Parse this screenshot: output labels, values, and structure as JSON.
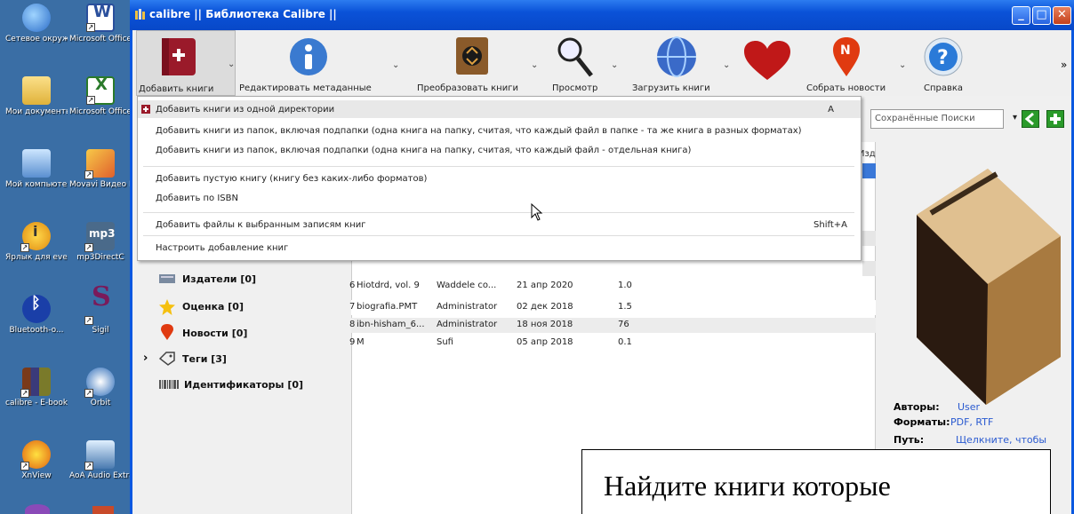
{
  "desktop": {
    "icons": [
      {
        "label": "Сетевое окружение",
        "icon": "network-icon"
      },
      {
        "label": "Microsoft Office W",
        "icon": "word-icon"
      },
      {
        "label": "Мои документы",
        "icon": "documents-icon"
      },
      {
        "label": "Microsoft Office Ex",
        "icon": "excel-icon"
      },
      {
        "label": "Мой компьютер",
        "icon": "computer-icon"
      },
      {
        "label": "Movavi Видео Конвертер",
        "icon": "movavi-icon"
      },
      {
        "label": "Ярлык для everest",
        "icon": "everest-icon"
      },
      {
        "label": "mp3DirectC",
        "icon": "mp3-icon"
      },
      {
        "label": "Bluetooth-o...",
        "icon": "bluetooth-icon"
      },
      {
        "label": "Sigil",
        "icon": "sigil-icon"
      },
      {
        "label": "calibre - E-book ma...",
        "icon": "calibre-icon"
      },
      {
        "label": "Orbit",
        "icon": "orbit-icon"
      },
      {
        "label": "XnView",
        "icon": "xnview-icon"
      },
      {
        "label": "AoA Audio Extractor",
        "icon": "aoa-icon"
      }
    ]
  },
  "window": {
    "title": "calibre || Библиотека Calibre ||",
    "buttons": {
      "minimize": "_",
      "maximize": "□",
      "close": "✕"
    }
  },
  "toolbar": {
    "add": "Добавить книги",
    "edit": "Редактировать метаданные",
    "convert": "Преобразовать книги",
    "view": "Просмотр",
    "fetch": "Загрузить книги",
    "news": "Собрать новости",
    "help": "Справка",
    "more": "»"
  },
  "menu": {
    "items": [
      {
        "label": "Добавить книги из одной директории",
        "shortcut": "A"
      },
      {
        "label": "Добавить книги из папок, включая подпапки (одна книга на папку, считая, что каждый файл в папке - та же книга в разных форматах)",
        "shortcut": ""
      },
      {
        "label": "Добавить книги из папок, включая подпапки (одна книга на папку, считая, что каждый файл - отдельная книга)",
        "shortcut": ""
      },
      {
        "label": "Добавить пустую книгу (книгу без каких-либо форматов)",
        "shortcut": ""
      },
      {
        "label": "Добавить по ISBN",
        "shortcut": ""
      },
      {
        "label": "Добавить файлы к выбранным записям книг",
        "shortcut": "Shift+A"
      },
      {
        "label": "Настроить добавление книг",
        "shortcut": ""
      }
    ]
  },
  "tagbrowser": {
    "publishers": "Издатели [0]",
    "rating": "Оценка [0]",
    "news": "Новости [0]",
    "tags": "Теги [3]",
    "identifiers": "Идентификаторы [0]",
    "expand": "›"
  },
  "booklist": {
    "col_partial": "Изд",
    "rows": [
      {
        "n": "6",
        "title": "Hiotdrd, vol. 9",
        "author": "Waddele co...",
        "date": "21 апр 2020",
        "size": "1.0"
      },
      {
        "n": "7",
        "title": "biografia.PMT",
        "author": "Administrator",
        "date": "02 дек 2018",
        "size": "1.5"
      },
      {
        "n": "8",
        "title": "ibn-hisham_6...",
        "author": "Administrator",
        "date": "18 ноя 2018",
        "size": "76"
      },
      {
        "n": "9",
        "title": "M",
        "author": "Sufi",
        "date": "05 апр 2018",
        "size": "0.1"
      }
    ]
  },
  "search": {
    "placeholder": "Сохранённые Поиски"
  },
  "details": {
    "authors_label": "Авторы:",
    "authors": "User",
    "formats_label": "Форматы:",
    "formats": "PDF, RTF",
    "path_label": "Путь:",
    "path": "Щелкните, чтобы"
  },
  "caption": "Найдите книги которые"
}
